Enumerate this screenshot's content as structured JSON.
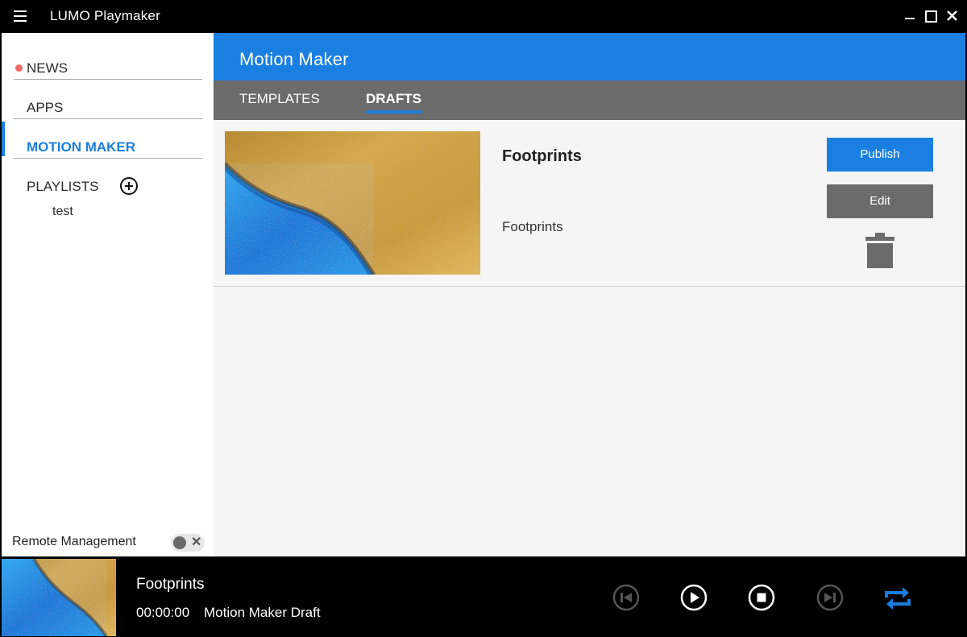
{
  "window": {
    "title": "LUMO Playmaker"
  },
  "sidebar": {
    "items": [
      {
        "label": "NEWS"
      },
      {
        "label": "APPS"
      },
      {
        "label": "MOTION MAKER"
      },
      {
        "label": "PLAYLISTS"
      }
    ],
    "playlists": [
      {
        "label": "test"
      }
    ],
    "remote_management": {
      "label": "Remote Management",
      "enabled": false
    }
  },
  "main": {
    "title": "Motion Maker",
    "tabs": [
      {
        "label": "TEMPLATES",
        "active": false
      },
      {
        "label": "DRAFTS",
        "active": true
      }
    ],
    "drafts": [
      {
        "title": "Footprints",
        "subtitle": "Footprints",
        "publish_label": "Publish",
        "edit_label": "Edit"
      }
    ]
  },
  "player": {
    "track_title": "Footprints",
    "time": "00:00:00",
    "source": "Motion Maker Draft"
  },
  "colors": {
    "accent": "#1a7fe0",
    "tab_bar": "#6b6b6b",
    "news_dot": "#f06a6a"
  }
}
